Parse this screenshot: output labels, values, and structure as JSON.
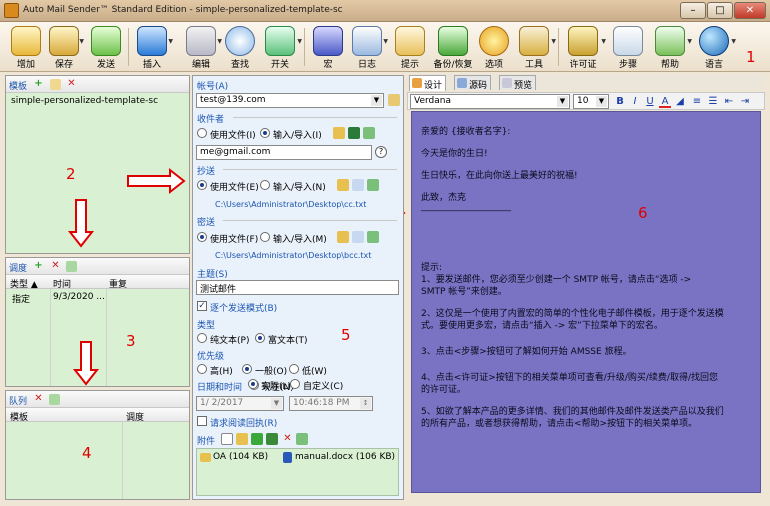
{
  "window": {
    "title": "Auto Mail Sender™ Standard Edition - simple-personalized-template-sc",
    "minimize": "–",
    "maximize": "□",
    "close": "✕"
  },
  "toolbar": {
    "items": [
      {
        "label": "增加",
        "icon": "add-envelope-icon"
      },
      {
        "label": "保存",
        "icon": "save-envelope-icon"
      },
      {
        "label": "发送",
        "icon": "send-envelope-icon"
      },
      {
        "label": "插入",
        "icon": "insert-arrow-icon"
      },
      {
        "label": "编辑",
        "icon": "edit-pencil-icon"
      },
      {
        "label": "查找",
        "icon": "find-magnifier-icon"
      },
      {
        "label": "开关",
        "icon": "switch-icon"
      },
      {
        "label": "宏",
        "icon": "macro-icon"
      },
      {
        "label": "日志",
        "icon": "log-calendar-icon"
      },
      {
        "label": "提示",
        "icon": "tip-icon"
      },
      {
        "label": "备份/恢复",
        "icon": "backup-restore-icon"
      },
      {
        "label": "选项",
        "icon": "options-gear-icon"
      },
      {
        "label": "工具",
        "icon": "tools-icon"
      },
      {
        "label": "许可证",
        "icon": "license-key-icon"
      },
      {
        "label": "步骤",
        "icon": "steps-icon"
      },
      {
        "label": "帮助",
        "icon": "help-icon"
      },
      {
        "label": "语言",
        "icon": "language-globe-icon"
      }
    ]
  },
  "markers": [
    "1",
    "2",
    "3",
    "4",
    "5",
    "6"
  ],
  "templates_panel": {
    "title": "模板",
    "items": [
      "simple-personalized-template-sc"
    ]
  },
  "schedule_panel": {
    "title": "调度",
    "columns": [
      "类型 ▲",
      "时间",
      "重复"
    ],
    "rows": [
      [
        "指定",
        "9/3/2020 ...",
        ""
      ]
    ]
  },
  "queue_panel": {
    "title": "队列",
    "columns": [
      "模板",
      "调度"
    ]
  },
  "settings": {
    "account_label": "帐号(A)",
    "account_value": "test@139.com",
    "recipient_label": "收件者",
    "use_file": "使用文件(I)",
    "input_import": "输入/导入(I)",
    "recipient_value": "me@gmail.com",
    "cc_label": "抄送",
    "cc_use_file": "使用文件(E)",
    "cc_input": "输入/导入(N)",
    "cc_path": "C:\\Users\\Administrator\\Desktop\\cc.txt",
    "bcc_label": "密送",
    "bcc_use_file": "使用文件(F)",
    "bcc_input": "输入/导入(M)",
    "bcc_path": "C:\\Users\\Administrator\\Desktop\\bcc.txt",
    "subject_label": "主题(S)",
    "subject_value": "测试邮件",
    "one_by_one": "逐个发送模式(B)",
    "type_label": "类型",
    "plain_text": "纯文本(P)",
    "rich_text": "富文本(T)",
    "priority_label": "优先级",
    "high": "高(H)",
    "normal": "一般(O)",
    "low": "低(W)",
    "datetime_label": "日期和时间",
    "now": "现在(N)",
    "actual": "实际(L)",
    "custom": "自定义(C)",
    "date_value": "1/ 2/2017",
    "time_value": "10:46:18 PM",
    "read_receipt": "请求阅读回执(R)",
    "attachments_label": "附件",
    "attachments": [
      {
        "name": "OA (104 KB)",
        "icon": "folder-icon"
      },
      {
        "name": "manual.docx (106 KB)",
        "icon": "word-doc-icon"
      }
    ]
  },
  "editor": {
    "tabs": [
      "设计",
      "源码",
      "预览"
    ],
    "font": "Verdana",
    "size": "10",
    "format_buttons": [
      "B",
      "I",
      "U",
      "A"
    ],
    "lines": [
      "亲爱的 {接收者名字}:",
      "今天是你的生日!",
      "生日快乐，在此向你送上最美好的祝福!",
      "此致，杰克",
      "____________________",
      "提示:",
      "1、要发送邮件，您必须至少创建一个 SMTP 帐号，请点击“选项 ->",
      "SMTP 帐号”来创建。",
      "2、这仅是一个使用了内置宏的简单的个性化电子邮件模板，用于逐个发送模",
      "式。要使用更多宏，请点击“插入 -> 宏”下拉菜单下的宏名。",
      "3、点击<步骤>按钮可了解如何开始 AMSSE 旅程。",
      "4、点击<许可证>按钮下的相关菜单项可查看/升级/购买/续费/取得/找回您",
      "的许可证。",
      "5、如欲了解本产品的更多详情、我们的其他邮件及邮件发送类产品以及我们",
      "的所有产品，或者想获得帮助，请点击<帮助>按钮下的相关菜单项。"
    ]
  },
  "colors": {
    "editor_bg": "#7a73c4",
    "marker": "#e10000",
    "panel_green": "#d9f0d2",
    "label_blue": "#1b55b0"
  }
}
